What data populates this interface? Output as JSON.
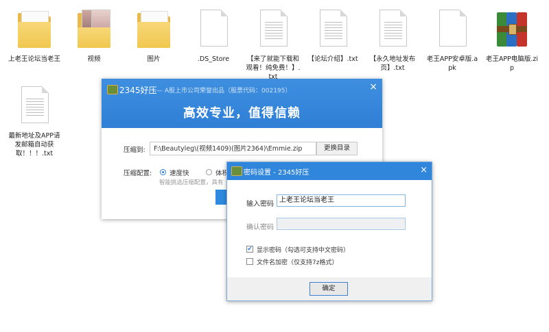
{
  "desktop": {
    "files": [
      {
        "name": "上老王论坛当老王",
        "type": "folder"
      },
      {
        "name": "视频",
        "type": "folder"
      },
      {
        "name": "图片",
        "type": "folder"
      },
      {
        "name": ".DS_Store",
        "type": "file"
      },
      {
        "name": "【来了就能下载和观看！纯免费！】.txt",
        "type": "txt"
      },
      {
        "name": "【论坛介绍】.txt",
        "type": "txt"
      },
      {
        "name": "【永久地址发布页】.txt",
        "type": "txt"
      },
      {
        "name": "老王APP安卓版.apk",
        "type": "file"
      },
      {
        "name": "老王APP电脑版.zip",
        "type": "archive"
      },
      {
        "name": "最新地址及APP请发邮箱自动获取！！！.txt",
        "type": "txt"
      }
    ]
  },
  "compress_window": {
    "app_name": "2345好压",
    "subtitle": "— A股上市公司荣誉出品（股票代码：002195）",
    "slogan": "高效专业，值得信赖",
    "path_label": "压缩到:",
    "path_value": "F:\\Beautyleg\\(视频1409)(图片2364)\\Emmie.zip",
    "change_dir_button": "更换目录",
    "config_label": "压缩配置:",
    "option_fast": "速度快",
    "option_small": "体积",
    "hint": "智能挑选压缩配置，具有",
    "close": "×"
  },
  "password_dialog": {
    "title": "密码设置 - 2345好压",
    "password_label": "输入密码",
    "password_value": "上老王论坛当老王",
    "confirm_label": "确认密码",
    "confirm_value": "",
    "show_password": {
      "label": "显示密码（勾选可支持中文密码）",
      "checked": true
    },
    "encrypt_filenames": {
      "label": "文件名加密（仅支持7z格式）",
      "checked": false
    },
    "ok_button": "确定",
    "close": "×"
  },
  "colors": {
    "title_blue": "#2f7fd6",
    "folder_yellow": "#f0c850"
  }
}
